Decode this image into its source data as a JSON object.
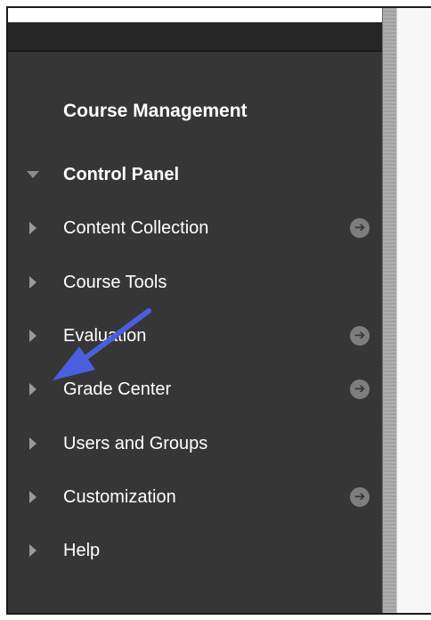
{
  "sidebar": {
    "heading": "Course Management",
    "control_panel_label": "Control Panel",
    "items": [
      {
        "label": "Content Collection",
        "has_go_icon": true
      },
      {
        "label": "Course Tools",
        "has_go_icon": false
      },
      {
        "label": "Evaluation",
        "has_go_icon": true
      },
      {
        "label": "Grade Center",
        "has_go_icon": true
      },
      {
        "label": "Users and Groups",
        "has_go_icon": false
      },
      {
        "label": "Customization",
        "has_go_icon": true
      },
      {
        "label": "Help",
        "has_go_icon": false
      }
    ]
  },
  "icons": {
    "expanded": "triangle-down-icon",
    "collapsed": "triangle-right-icon",
    "go": "arrow-circle-right-icon",
    "annotation": "annotation-arrow"
  },
  "colors": {
    "sidebar_bg": "#363636",
    "top_bar_bg": "#262626",
    "text": "#ffffff",
    "icon_gray": "#9a9a9a",
    "annotation_arrow": "#4a5fe0"
  }
}
